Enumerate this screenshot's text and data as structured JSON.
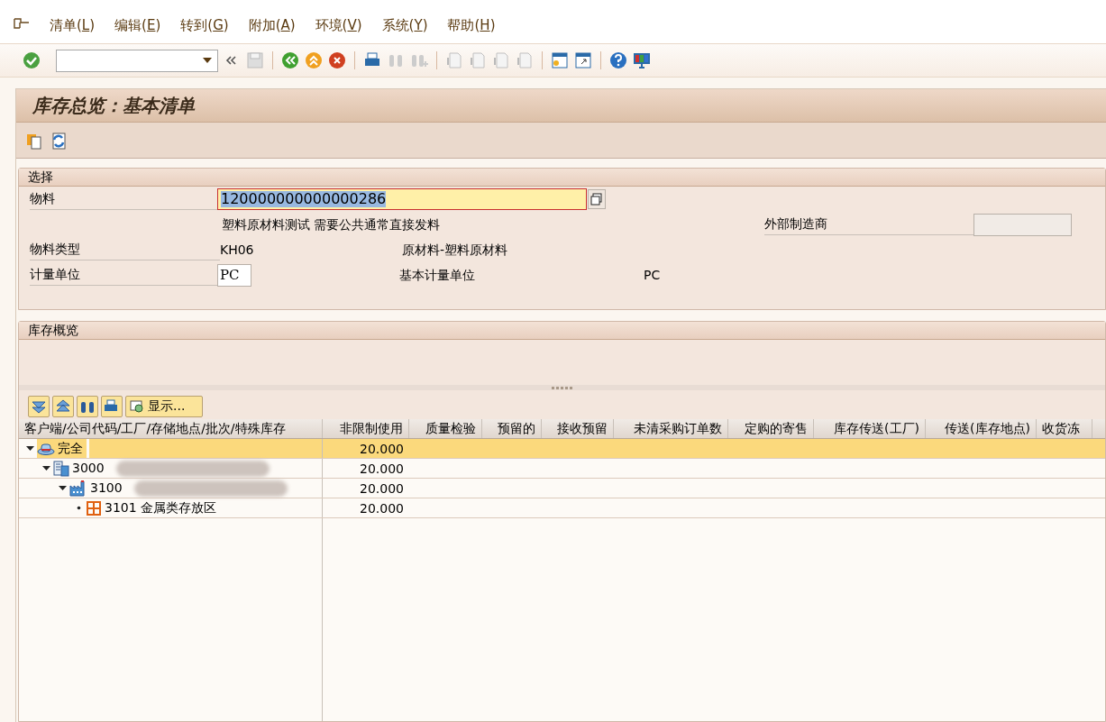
{
  "menu": [
    {
      "before": "清单(",
      "key": "L",
      "after": ")"
    },
    {
      "before": "编辑(",
      "key": "E",
      "after": ")"
    },
    {
      "before": "转到(",
      "key": "G",
      "after": ")"
    },
    {
      "before": "附加(",
      "key": "A",
      "after": ")"
    },
    {
      "before": "环境(",
      "key": "V",
      "after": ")"
    },
    {
      "before": "系统(",
      "key": "Y",
      "after": ")"
    },
    {
      "before": "帮助(",
      "key": "H",
      "after": ")"
    }
  ],
  "title": "库存总览：基本清单",
  "selection": {
    "title": "选择",
    "material": {
      "label": "物料",
      "value": "120000000000000286",
      "description": "塑料原材料测试 需要公共通常直接发料"
    },
    "manufacturer": {
      "label": "外部制造商"
    },
    "material_type": {
      "label": "物料类型",
      "value": "KH06",
      "description": "原材料-塑料原材料"
    },
    "unit": {
      "label": "计量单位",
      "value": "PC",
      "base_label": "基本计量单位",
      "base_value": "PC"
    }
  },
  "overview": {
    "title": "库存概览",
    "display_button": "显示..."
  },
  "table": {
    "columns": [
      "客户端/公司代码/工厂/存储地点/批次/特殊库存",
      "非限制使用",
      "质量检验",
      "预留的",
      "接收预留",
      "未清采购订单数",
      "定购的寄售",
      "库存传送(工厂)",
      "传送(库存地点)",
      "收货冻"
    ],
    "rows": [
      {
        "kind": "client",
        "label": "完全",
        "expanded": true,
        "selected": true,
        "redacted": false,
        "unrestricted": "20.000",
        "children": [
          {
            "kind": "company",
            "label": "3000",
            "expanded": true,
            "selected": false,
            "redacted": true,
            "unrestricted": "20.000",
            "children": [
              {
                "kind": "plant",
                "label": "3100",
                "expanded": true,
                "selected": false,
                "redacted": true,
                "unrestricted": "20.000",
                "children": [
                  {
                    "kind": "storage",
                    "label": "3101 金属类存放区",
                    "selected": false,
                    "redacted": false,
                    "unrestricted": "20.000"
                  }
                ]
              }
            ]
          }
        ]
      }
    ]
  }
}
